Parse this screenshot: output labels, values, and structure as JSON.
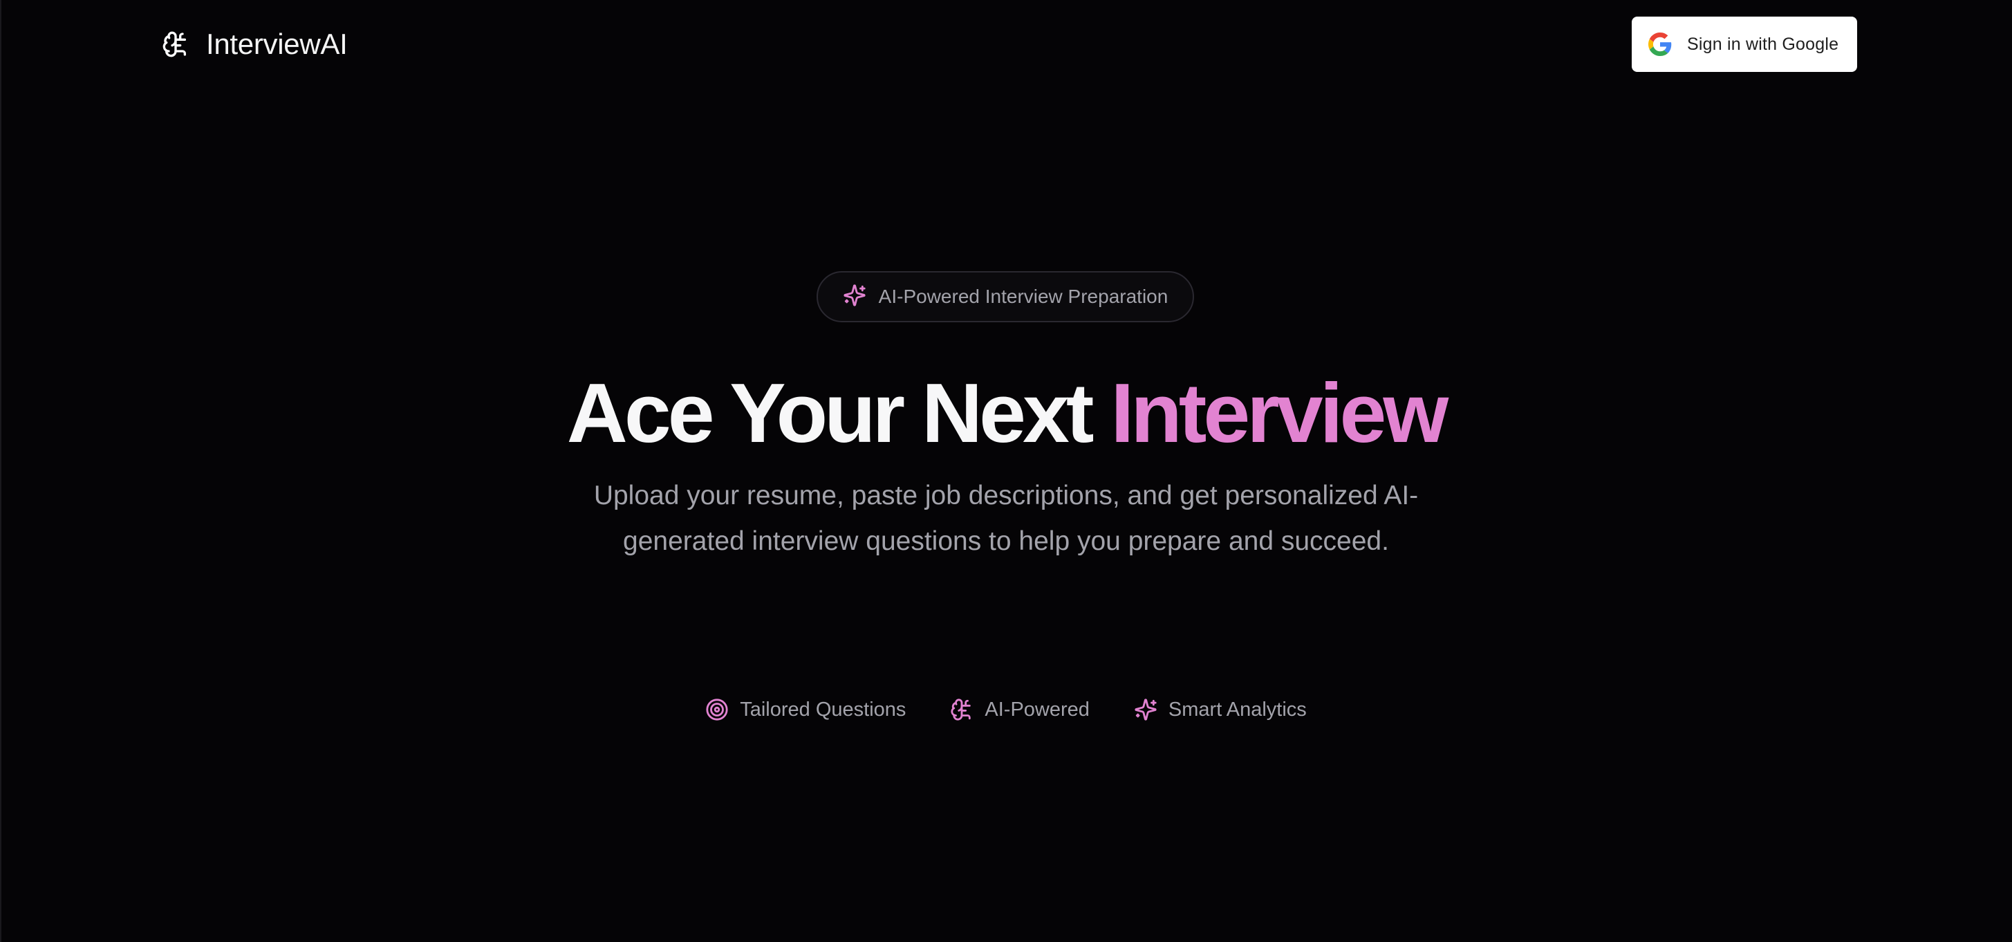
{
  "header": {
    "brand_name": "InterviewAI",
    "brand_icon": "brain-icon",
    "signin_label": "Sign in with Google",
    "signin_icon": "google-icon"
  },
  "hero": {
    "badge_icon": "sparkles-icon",
    "badge_label": "AI-Powered Interview Preparation",
    "title_plain": "Ace Your Next ",
    "title_accent": "Interview",
    "subtitle": "Upload your resume, paste job descriptions, and get personalized AI-generated interview questions to help you prepare and succeed."
  },
  "features": [
    {
      "icon": "target-icon",
      "label": "Tailored Questions"
    },
    {
      "icon": "brain-icon",
      "label": "AI-Powered"
    },
    {
      "icon": "sparkles-icon",
      "label": "Smart Analytics"
    }
  ],
  "colors": {
    "background": "#050406",
    "accent": "#e283d1",
    "muted_text": "#a3a3ab",
    "title_text": "#f7f7f8"
  }
}
